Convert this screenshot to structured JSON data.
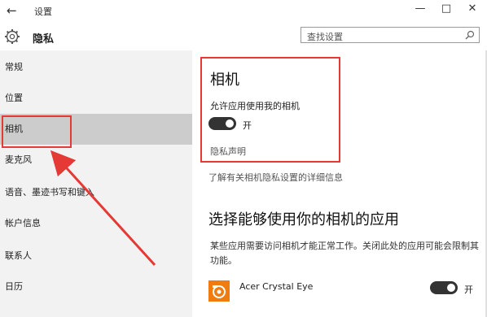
{
  "window": {
    "back_icon": "arrow-left-icon",
    "title": "设置",
    "controls": [
      "—",
      "□",
      "✕"
    ]
  },
  "header": {
    "icon": "gear-icon",
    "title": "隐私",
    "search_placeholder": "查找设置",
    "search_icon": "search-icon"
  },
  "sidebar": {
    "items": [
      {
        "label": "常规"
      },
      {
        "label": "位置"
      },
      {
        "label": "相机",
        "selected": true
      },
      {
        "label": "麦克风"
      },
      {
        "label": "语音、墨迹书写和键入"
      },
      {
        "label": "帐户信息"
      },
      {
        "label": "联系人"
      },
      {
        "label": "日历"
      }
    ]
  },
  "main": {
    "title": "相机",
    "allow_label": "允许应用使用我的相机",
    "allow_state": "开",
    "privacy_link": "隐私声明",
    "learn_more_link": "了解有关相机隐私设置的详细信息",
    "apps_title": "选择能够使用你的相机的应用",
    "apps_desc": "某些应用需要访问相机才能正常工作。关闭此处的应用可能会限制其功能。",
    "apps": [
      {
        "name": "Acer Crystal Eye",
        "state": "开",
        "icon": "camera-app-icon"
      }
    ]
  },
  "colors": {
    "annotation": "#e53935",
    "selected_bg": "#cccccc",
    "sidebar_bg": "#f2f2f2",
    "toggle_on": "#333333",
    "app_icon": "#f07c10"
  }
}
